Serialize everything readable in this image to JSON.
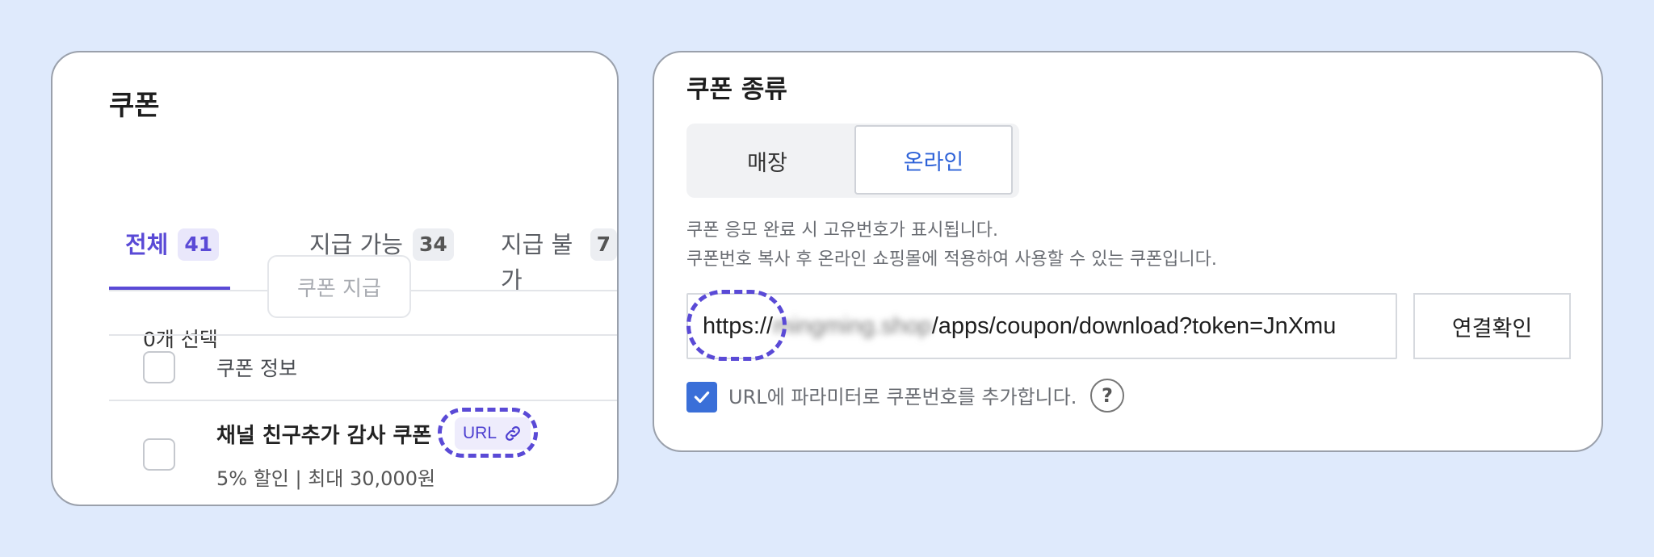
{
  "left_panel": {
    "title": "쿠폰",
    "tabs": [
      {
        "label": "전체",
        "count": "41",
        "active": true
      },
      {
        "label": "지급 가능",
        "count": "34",
        "active": false
      },
      {
        "label": "지급 불가",
        "count": "7",
        "active": false
      }
    ],
    "selected_count": "0개 선택",
    "issue_button": "쿠폰 지급",
    "column_header": "쿠폰 정보",
    "coupon": {
      "name": "채널 친구추가 감사 쿠폰",
      "badge": "URL",
      "description": "5% 할인 | 최대 30,000원"
    }
  },
  "right_panel": {
    "title": "쿠폰 종류",
    "segments": {
      "store": "매장",
      "online": "온라인"
    },
    "descriptions": [
      "쿠폰 응모 완료 시 고유번호가 표시됩니다.",
      "쿠폰번호 복사 후 온라인 쇼핑몰에 적용하여 사용할 수 있는 쿠폰입니다."
    ],
    "url": {
      "prefix": "https://",
      "blurred_host": "mingming.shop",
      "path": "/apps/coupon/download?token=JnXmu"
    },
    "verify_button": "연결확인",
    "param_checkbox_label": "URL에 파라미터로 쿠폰번호를 추가합니다.",
    "help_icon": "?"
  },
  "colors": {
    "background": "#dfeafc",
    "accent_purple": "#5a4ad6",
    "accent_blue": "#2f63d8",
    "checkbox_blue": "#3a6fd8"
  }
}
